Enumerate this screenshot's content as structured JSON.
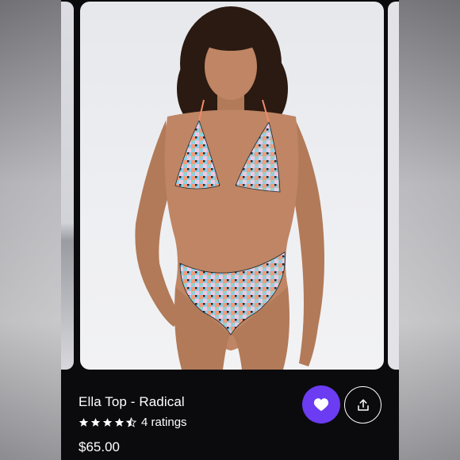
{
  "product": {
    "title": "Ella Top - Radical",
    "rating": 4.5,
    "ratings_label": "4 ratings",
    "price": "$65.00"
  },
  "image": {
    "icon": "product-photo"
  },
  "actions": {
    "like_icon": "heart-icon",
    "share_icon": "share-icon"
  },
  "colors": {
    "accent": "#6b3cf2",
    "background": "#0b0b0d",
    "text": "#ffffff"
  }
}
